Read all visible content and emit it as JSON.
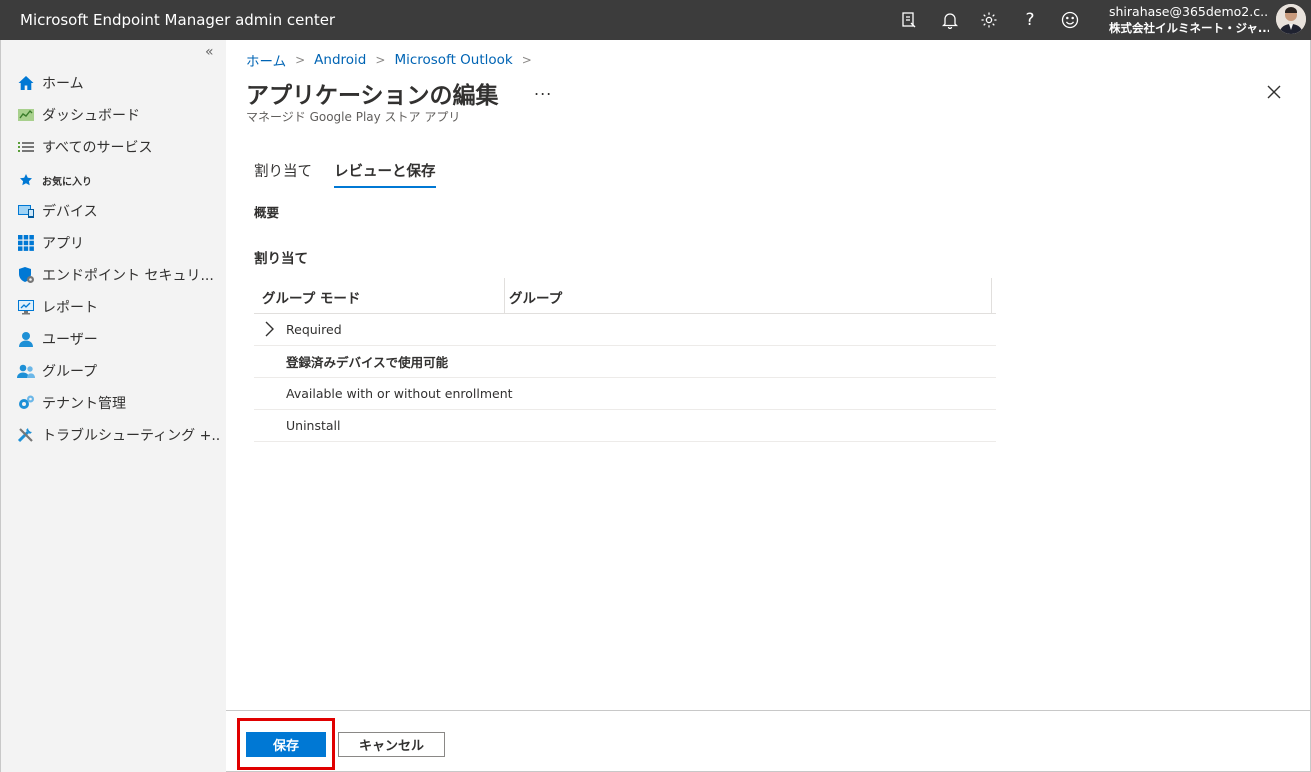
{
  "header": {
    "app_title": "Microsoft Endpoint Manager admin center",
    "icons": [
      "feedback-icon",
      "bell-icon",
      "gear-icon",
      "help-icon",
      "smiley-icon"
    ],
    "account_email": "shirahase@365demo2.c...",
    "account_org": "株式会社イルミネート・ジャ..."
  },
  "sidebar": {
    "items": [
      {
        "label": "ホーム",
        "icon": "home-icon"
      },
      {
        "label": "ダッシュボード",
        "icon": "dashboard-icon"
      },
      {
        "label": "すべてのサービス",
        "icon": "list-icon"
      },
      {
        "label": "お気に入り",
        "icon": "star-icon"
      },
      {
        "label": "デバイス",
        "icon": "device-icon"
      },
      {
        "label": "アプリ",
        "icon": "apps-icon"
      },
      {
        "label": "エンドポイント セキュリ...",
        "icon": "shield-icon"
      },
      {
        "label": "レポート",
        "icon": "report-icon"
      },
      {
        "label": "ユーザー",
        "icon": "user-icon"
      },
      {
        "label": "グループ",
        "icon": "group-icon"
      },
      {
        "label": "テナント管理",
        "icon": "tenant-icon"
      },
      {
        "label": "トラブルシューティング +...",
        "icon": "tools-icon"
      }
    ]
  },
  "breadcrumb": [
    "ホーム",
    "Android",
    "Microsoft Outlook"
  ],
  "page": {
    "title": "アプリケーションの編集",
    "more": "...",
    "subtitle": "マネージド Google Play ストア アプリ"
  },
  "tabs": [
    {
      "label": "割り当て",
      "active": false
    },
    {
      "label": "レビューと保存",
      "active": true
    }
  ],
  "summary_label": "概要",
  "assignments": {
    "heading": "割り当て",
    "columns": [
      "グループ モード",
      "グループ"
    ],
    "rows": [
      {
        "label": "Required",
        "expandable": true,
        "bold": false
      },
      {
        "label": "登録済みデバイスで使用可能",
        "expandable": false,
        "bold": true
      },
      {
        "label": "Available with or without enrollment",
        "expandable": false,
        "bold": false
      },
      {
        "label": "Uninstall",
        "expandable": false,
        "bold": false
      }
    ]
  },
  "footer": {
    "save_label": "保存",
    "cancel_label": "キャンセル"
  },
  "colors": {
    "topbar": "#3c3c3c",
    "accent": "#0078d4",
    "link": "#0064b4",
    "highlight": "#e00000"
  }
}
